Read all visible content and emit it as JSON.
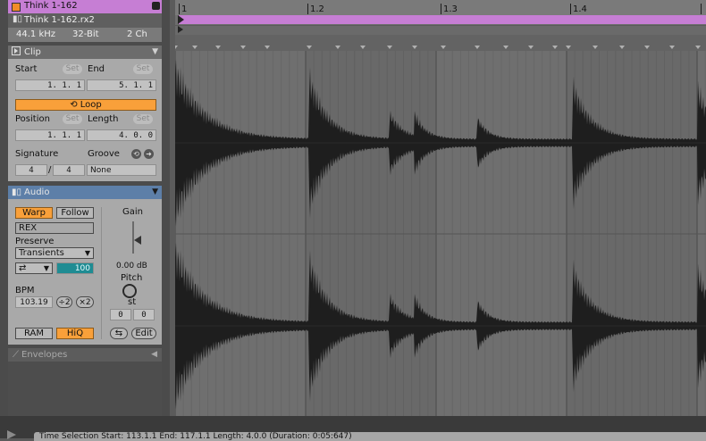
{
  "clip_header": {
    "clip_name": "Think 1-162",
    "file_name": "Think 1-162.rx2",
    "sample_rate": "44.1 kHz",
    "bit_depth": "32-Bit",
    "channels": "2 Ch",
    "clip_color": "#f28c28"
  },
  "clip": {
    "title": "Clip",
    "start_label": "Start",
    "end_label": "End",
    "set_label": "Set",
    "start_value": "1.  1.  1",
    "end_value": "5.  1.  1",
    "loop_label": "Loop",
    "position_label": "Position",
    "length_label": "Length",
    "position_value": "1.  1.  1",
    "length_value": "4.  0.  0",
    "signature_label": "Signature",
    "groove_label": "Groove",
    "sig_num": "4",
    "sig_sep": "/",
    "sig_den": "4",
    "groove_value": "None"
  },
  "audio": {
    "title": "Audio",
    "warp_label": "Warp",
    "follow_label": "Follow",
    "rex_label": "REX",
    "preserve_label": "Preserve",
    "preserve_value": "Transients",
    "transient_env": "100",
    "bpm_label": "BPM",
    "bpm_value": "103.19",
    "halve_label": "÷2",
    "double_label": "×2",
    "gain_label": "Gain",
    "gain_value": "0.00 dB",
    "pitch_label": "Pitch",
    "st_label": "st",
    "pitch_coarse": "0",
    "pitch_fine": "0",
    "ram_label": "RAM",
    "hiq_label": "HiQ",
    "edit_label": "Edit"
  },
  "envelopes": {
    "title": "Envelopes"
  },
  "timeline": {
    "markers": [
      "1",
      "1.2",
      "1.3",
      "1.4"
    ],
    "clip_color": "#c67ed4"
  },
  "status": {
    "text": "Time Selection    Start: 113.1.1    End: 117.1.1    Length: 4.0.0  (Duration: 0:05:647)"
  },
  "colors": {
    "accent": "#f9a03a",
    "teal": "#1f8c93",
    "purple": "#c67ed4"
  }
}
